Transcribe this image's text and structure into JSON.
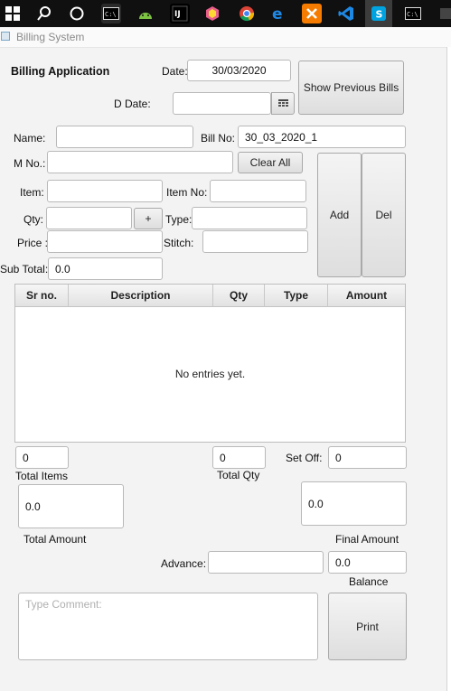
{
  "window": {
    "title": "Billing System"
  },
  "header": {
    "app_title": "Billing Application",
    "date_label": "Date:",
    "date_value": "30/03/2020",
    "ddate_label": "D Date:",
    "ddate_value": "",
    "show_previous_label": "Show Previous Bills"
  },
  "form": {
    "name_label": "Name:",
    "name_value": "",
    "bill_no_label": "Bill No:",
    "bill_no_value": "30_03_2020_1",
    "m_no_label": "M No.:",
    "m_no_value": "",
    "clear_all_label": "Clear All",
    "item_label": "Item:",
    "item_value": "",
    "item_no_label": "Item No:",
    "item_no_value": "",
    "qty_label": "Qty:",
    "qty_value": "",
    "plus_label": "+",
    "type_label": "Type:",
    "type_value": "",
    "price_label": "Price :",
    "price_value": "",
    "stitch_label": "Stitch:",
    "stitch_value": "",
    "subtotal_label": "Sub Total:",
    "subtotal_value": "0.0",
    "add_label": "Add",
    "del_label": "Del"
  },
  "table": {
    "columns": [
      "Sr no.",
      "Description",
      "Qty",
      "Type",
      "Amount"
    ],
    "empty_message": "No entries yet."
  },
  "totals": {
    "total_items_value": "0",
    "total_items_label": "Total Items",
    "total_qty_value": "0",
    "total_qty_label": "Total Qty",
    "set_off_label": "Set Off:",
    "set_off_value": "0",
    "total_amount_value": "0.0",
    "total_amount_label": "Total Amount",
    "final_amount_value": "0.0",
    "final_amount_label": "Final Amount",
    "advance_label": "Advance:",
    "advance_value": "",
    "balance_value": "0.0",
    "balance_label": "Balance"
  },
  "comment": {
    "placeholder": "Type Comment:"
  },
  "print_label": "Print",
  "taskbar": {
    "icons": [
      "windows-start-icon",
      "search-icon",
      "cortana-icon",
      "cmd-icon",
      "android-studio-icon",
      "intellij-icon",
      "shield-app-icon",
      "chrome-icon",
      "edge-icon",
      "xampp-icon",
      "vscode-icon",
      "skype-icon",
      "cmd-icon-2"
    ]
  }
}
